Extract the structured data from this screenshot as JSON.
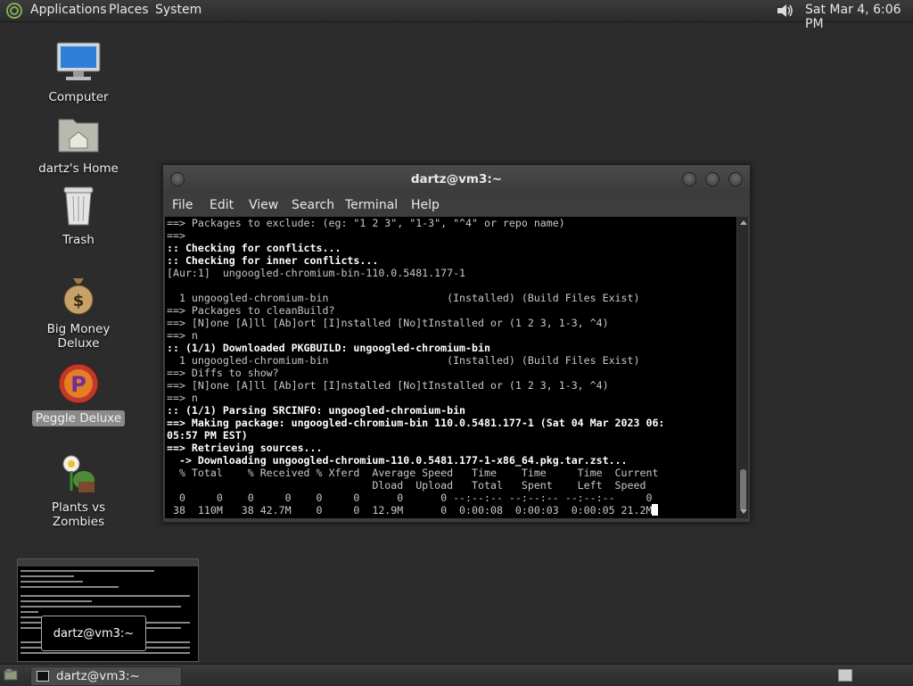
{
  "top_panel": {
    "menus": [
      "Applications",
      "Places",
      "System"
    ],
    "clock": "Sat Mar  4,  6:06 PM"
  },
  "desktop": {
    "icons": [
      {
        "label": "Computer"
      },
      {
        "label": "dartz's Home"
      },
      {
        "label": "Trash"
      },
      {
        "label": "Big Money Deluxe"
      },
      {
        "label": "Peggle Deluxe"
      },
      {
        "label": "Plants vs Zombies"
      }
    ]
  },
  "terminal": {
    "title": "dartz@vm3:~",
    "menu": [
      "File",
      "Edit",
      "View",
      "Search",
      "Terminal",
      "Help"
    ],
    "lines": [
      "==> Packages to exclude: (eg: \"1 2 3\", \"1-3\", \"^4\" or repo name)",
      "==>",
      ":: Checking for conflicts...",
      ":: Checking for inner conflicts...",
      "[Aur:1]  ungoogled-chromium-bin-110.0.5481.177-1",
      "",
      "  1 ungoogled-chromium-bin                   (Installed) (Build Files Exist)",
      "==> Packages to cleanBuild?",
      "==> [N]one [A]ll [Ab]ort [I]nstalled [No]tInstalled or (1 2 3, 1-3, ^4)",
      "==> n",
      ":: (1/1) Downloaded PKGBUILD: ungoogled-chromium-bin",
      "  1 ungoogled-chromium-bin                   (Installed) (Build Files Exist)",
      "==> Diffs to show?",
      "==> [N]one [A]ll [Ab]ort [I]nstalled [No]tInstalled or (1 2 3, 1-3, ^4)",
      "==> n",
      ":: (1/1) Parsing SRCINFO: ungoogled-chromium-bin",
      "==> Making package: ungoogled-chromium-bin 110.0.5481.177-1 (Sat 04 Mar 2023 06:",
      "05:57 PM EST)",
      "==> Retrieving sources...",
      "  -> Downloading ungoogled-chromium-110.0.5481.177-1-x86_64.pkg.tar.zst...",
      "  % Total    % Received % Xferd  Average Speed   Time    Time     Time  Current",
      "                                 Dload  Upload   Total   Spent    Left  Speed",
      "  0     0    0     0    0     0      0      0 --:--:-- --:--:-- --:--:--     0",
      " 38  110M   38 42.7M    0     0  12.9M      0  0:00:08  0:00:03  0:00:05 21.2M"
    ]
  },
  "thumbnail": {
    "tooltip": "dartz@vm3:~"
  },
  "bottom_panel": {
    "task_label": "dartz@vm3:~"
  }
}
